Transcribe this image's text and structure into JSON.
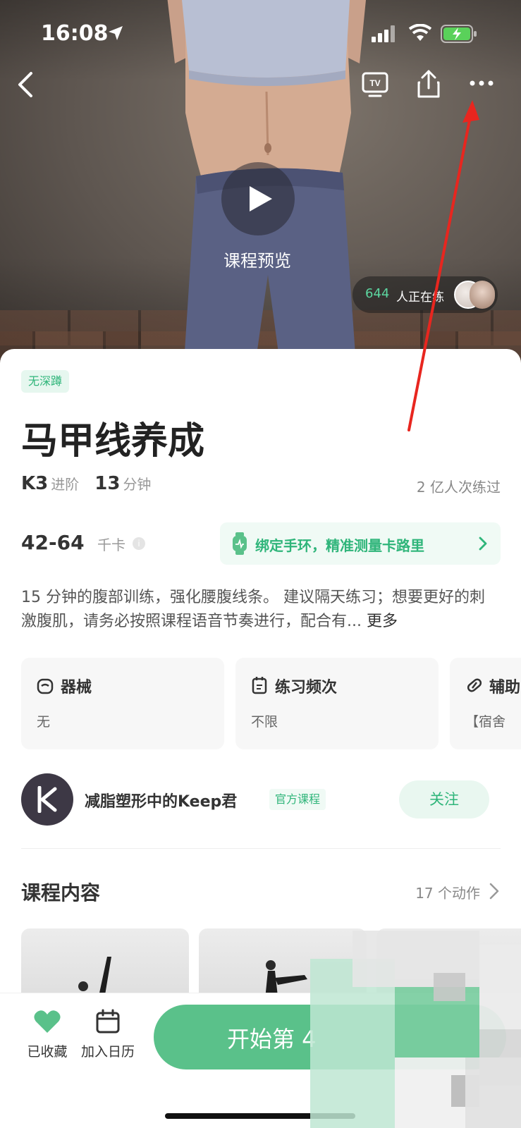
{
  "status_bar": {
    "time": "16:08"
  },
  "hero": {
    "preview_label": "课程预览",
    "live_count": "644",
    "live_text": "人正在练"
  },
  "course": {
    "tag": "无深蹲",
    "title": "马甲线养成",
    "level": "K3",
    "level_label": "进阶",
    "duration": "13",
    "duration_unit": "分钟",
    "participants": "2 亿人次练过",
    "kcal": "42-64",
    "kcal_unit": "千卡",
    "band_prompt": "绑定手环，精准测量卡路里",
    "description": "15 分钟的腹部训练，强化腰腹线条。 建议隔天练习；想要更好的刺激腹肌，请务必按照课程语音节奏进行，配合有...",
    "more": "更多"
  },
  "info_cards": [
    {
      "label": "器械",
      "value": "无",
      "icon": "kettlebell-icon"
    },
    {
      "label": "练习频次",
      "value": "不限",
      "icon": "calendar-icon"
    },
    {
      "label": "辅助",
      "value": "【宿舍",
      "icon": "pill-icon"
    }
  ],
  "author": {
    "name": "减脂塑形中的Keep君",
    "badge": "官方课程",
    "follow": "关注"
  },
  "content_section": {
    "title": "课程内容",
    "count": "17 个动作"
  },
  "bottom_bar": {
    "favorite_label": "已收藏",
    "calendar_label": "加入日历",
    "start_label": "开始第 4"
  },
  "colors": {
    "accent": "#2fb57a",
    "start_button": "#5ac18a",
    "annotation_arrow": "#e8261f"
  }
}
